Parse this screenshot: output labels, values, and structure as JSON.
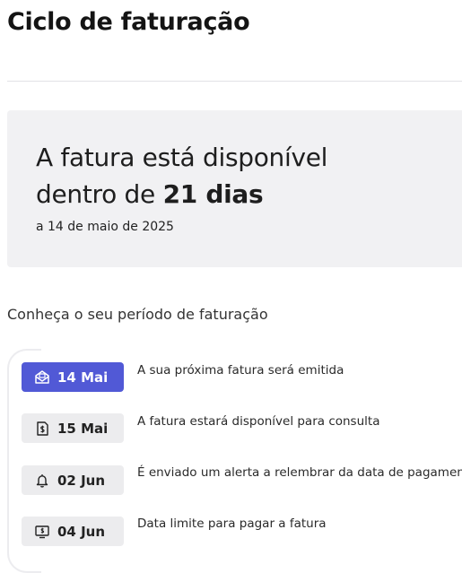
{
  "page": {
    "title": "Ciclo de faturação"
  },
  "summary": {
    "line1": "A fatura está disponível",
    "line2_prefix": "dentro de ",
    "line2_bold": "21 dias",
    "date_text": "a 14 de maio de 2025"
  },
  "timeline": {
    "title": "Conheça o seu período de faturação",
    "steps": [
      {
        "date": "14 Mai",
        "icon": "envelope-icon",
        "description": "A sua próxima fatura será emitida",
        "active": true
      },
      {
        "date": "15 Mai",
        "icon": "invoice-icon",
        "description": "A fatura estará disponível para consulta",
        "active": false
      },
      {
        "date": "02 Jun",
        "icon": "bell-icon",
        "description": "É enviado um alerta a relembrar da data de pagamento",
        "active": false
      },
      {
        "date": "04 Jun",
        "icon": "payment-icon",
        "description": "Data limite para pagar a fatura",
        "active": false
      }
    ]
  },
  "colors": {
    "accent": "#5159d6",
    "card_bg": "#f1f1f3",
    "pill_bg": "#ececee"
  }
}
